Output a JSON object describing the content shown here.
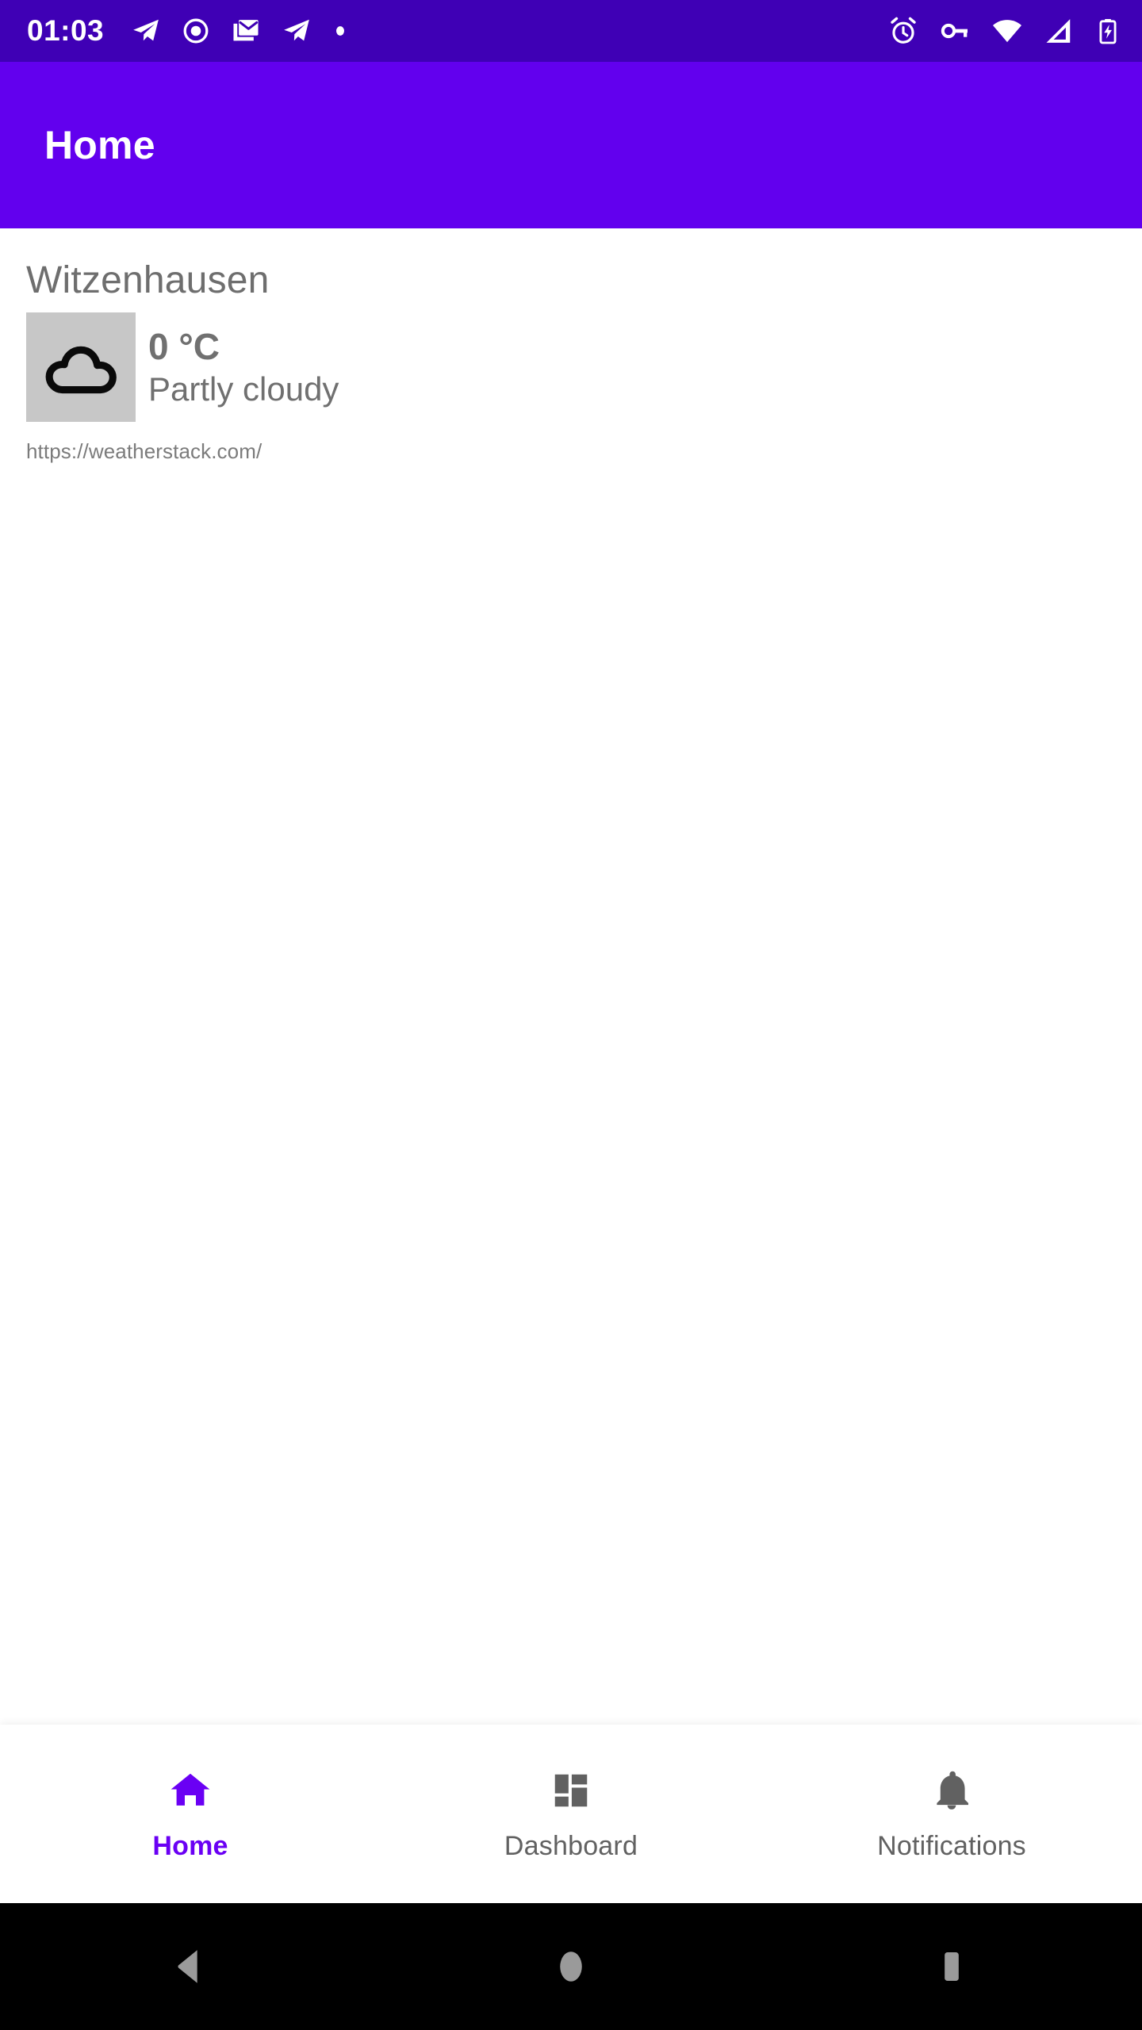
{
  "status_bar": {
    "time": "01:03",
    "background_color": "#3f00b5",
    "foreground_color": "#ffffff",
    "left_icons": [
      "telegram-icon",
      "record-circle-icon",
      "email-stack-icon",
      "telegram-icon",
      "dot-icon"
    ],
    "right_icons": [
      "alarm-clock-icon",
      "vpn-key-icon",
      "wifi-icon",
      "cellular-signal-icon",
      "battery-charging-icon"
    ]
  },
  "app_bar": {
    "title": "Home",
    "background_color": "#6200ee",
    "title_color": "#ffffff"
  },
  "weather": {
    "city": "Witzenhausen",
    "icon_name": "cloud-outline-icon",
    "icon_box_color": "#c7c7c7",
    "temperature": "0 °C",
    "condition": "Partly cloudy",
    "source_url": "https://weatherstack.com/"
  },
  "bottom_nav": {
    "active_color": "#6a00f4",
    "inactive_color": "#616161",
    "items": [
      {
        "label": "Home",
        "icon": "home-icon",
        "active": true
      },
      {
        "label": "Dashboard",
        "icon": "dashboard-grid-icon",
        "active": false
      },
      {
        "label": "Notifications",
        "icon": "bell-icon",
        "active": false
      }
    ]
  },
  "android_nav": {
    "background_color": "#000000",
    "icon_color": "#9a9a9a",
    "buttons": [
      {
        "name": "back-button",
        "icon": "triangle-left-icon"
      },
      {
        "name": "home-button",
        "icon": "circle-icon"
      },
      {
        "name": "recents-button",
        "icon": "square-icon"
      }
    ]
  }
}
